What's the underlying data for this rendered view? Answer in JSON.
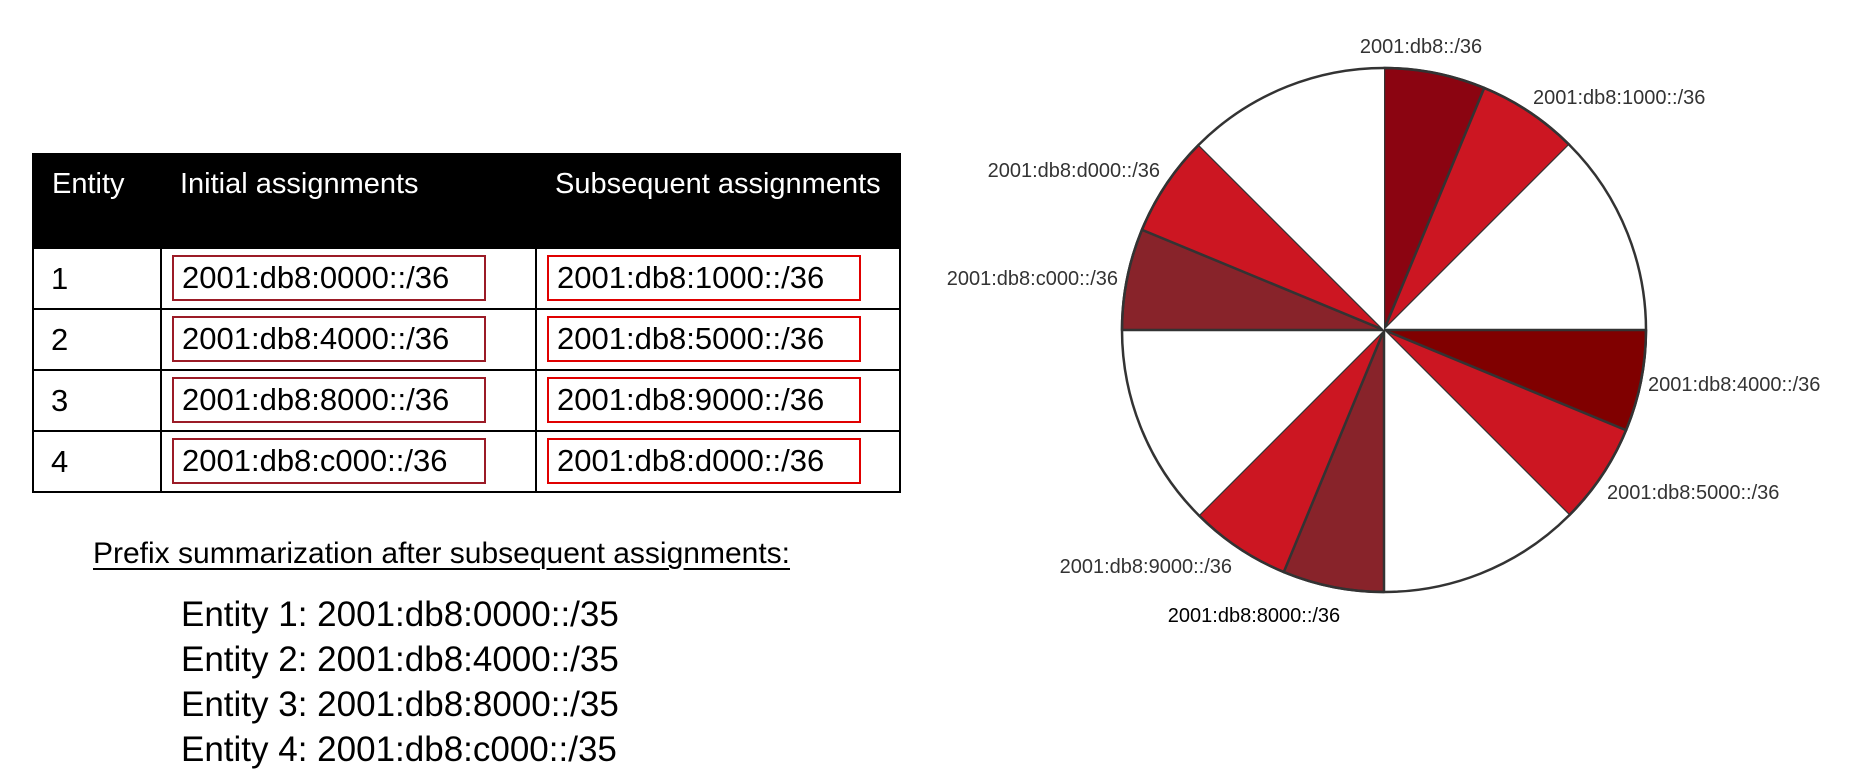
{
  "table": {
    "headers": [
      "Entity",
      "Initial assignments",
      "Subsequent assignments"
    ],
    "rows": [
      {
        "entity": "1",
        "initial": "2001:db8:0000::/36",
        "subsequent": "2001:db8:1000::/36"
      },
      {
        "entity": "2",
        "initial": "2001:db8:4000::/36",
        "subsequent": "2001:db8:5000::/36"
      },
      {
        "entity": "3",
        "initial": "2001:db8:8000::/36",
        "subsequent": "2001:db8:9000::/36"
      },
      {
        "entity": "4",
        "initial": "2001:db8:c000::/36",
        "subsequent": "2001:db8:d000::/36"
      }
    ],
    "colors": {
      "header_bg": "#000000",
      "initial_box": "#9b1b26",
      "subsequent_box": "#e00000"
    }
  },
  "summary": {
    "title": "Prefix summarization after subsequent assignments:",
    "lines": [
      "Entity 1:  2001:db8:0000::/35",
      "Entity 2: 2001:db8:4000::/35",
      "Entity 3: 2001:db8:8000::/35",
      "Entity 4: 2001:db8:c000::/35"
    ]
  },
  "pie": {
    "total_slices": 16,
    "slices": [
      {
        "index": 0,
        "label": "2001:db8::/36",
        "color": "#8b0411"
      },
      {
        "index": 1,
        "label": "2001:db8:1000::/36",
        "color": "#cc1622"
      },
      {
        "index": 2,
        "label": "",
        "color": "#ffffff"
      },
      {
        "index": 3,
        "label": "",
        "color": "#ffffff"
      },
      {
        "index": 4,
        "label": "2001:db8:4000::/36",
        "color": "#800000"
      },
      {
        "index": 5,
        "label": "2001:db8:5000::/36",
        "color": "#cc1622"
      },
      {
        "index": 6,
        "label": "",
        "color": "#ffffff"
      },
      {
        "index": 7,
        "label": "",
        "color": "#ffffff"
      },
      {
        "index": 8,
        "label": "2001:db8:8000::/36",
        "color": "#88232a"
      },
      {
        "index": 9,
        "label": "2001:db8:9000::/36",
        "color": "#cc1622"
      },
      {
        "index": 10,
        "label": "",
        "color": "#ffffff"
      },
      {
        "index": 11,
        "label": "",
        "color": "#ffffff"
      },
      {
        "index": 12,
        "label": "2001:db8:c000::/36",
        "color": "#88232a"
      },
      {
        "index": 13,
        "label": "2001:db8:d000::/36",
        "color": "#cc1622"
      },
      {
        "index": 14,
        "label": "",
        "color": "#ffffff"
      },
      {
        "index": 15,
        "label": "",
        "color": "#ffffff"
      }
    ],
    "stroke_color": "#333333"
  }
}
